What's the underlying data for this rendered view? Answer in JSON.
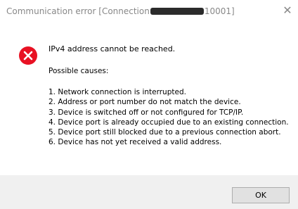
{
  "window": {
    "title_prefix": "Communication error [Connection",
    "title_suffix": "10001]",
    "close_glyph": "✕"
  },
  "message": {
    "heading": "IPv4 address cannot be reached.",
    "causes_label": "Possible causes:",
    "causes": [
      "1. Network connection is interrupted.",
      "2. Address or port number do not match the device.",
      "3. Device is switched off or not configured for TCP/IP.",
      "4. Device port is already occupied due to an existing connection.",
      "5. Device port still blocked due to a previous connection abort.",
      "6. Device has not yet received a valid address."
    ]
  },
  "icon": {
    "name": "error-icon",
    "color": "#e81123"
  },
  "buttons": {
    "ok_label": "OK"
  }
}
